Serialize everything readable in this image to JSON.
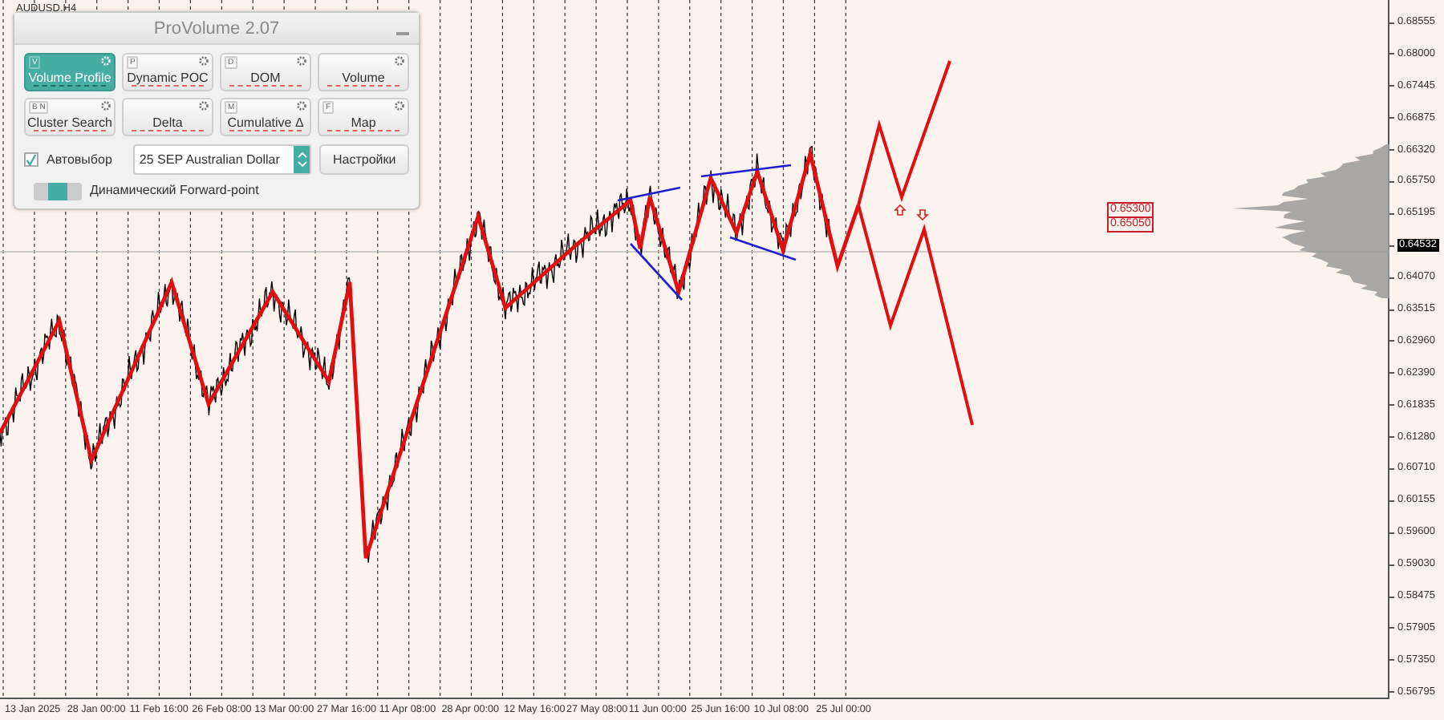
{
  "chart": {
    "symbol": "AUDUSD,H4",
    "price_labels": [
      {
        "text": "0.68555",
        "kind": "tick"
      },
      {
        "text": "0.68000",
        "kind": "tick"
      },
      {
        "text": "0.67445",
        "kind": "tick"
      },
      {
        "text": "0.66875",
        "kind": "tick"
      },
      {
        "text": "0.66320",
        "kind": "tick"
      },
      {
        "text": "0.65750",
        "kind": "tick"
      },
      {
        "text": "0.65195",
        "kind": "tick"
      },
      {
        "text": "0.64532",
        "kind": "current"
      },
      {
        "text": "0.64070",
        "kind": "tick"
      },
      {
        "text": "0.63515",
        "kind": "tick"
      },
      {
        "text": "0.62960",
        "kind": "tick"
      },
      {
        "text": "0.62390",
        "kind": "tick"
      },
      {
        "text": "0.61835",
        "kind": "tick"
      },
      {
        "text": "0.61280",
        "kind": "tick"
      },
      {
        "text": "0.60710",
        "kind": "tick"
      },
      {
        "text": "0.60155",
        "kind": "tick"
      },
      {
        "text": "0.59600",
        "kind": "tick"
      },
      {
        "text": "0.59030",
        "kind": "tick"
      },
      {
        "text": "0.58475",
        "kind": "tick"
      },
      {
        "text": "0.57905",
        "kind": "tick"
      },
      {
        "text": "0.57350",
        "kind": "tick"
      },
      {
        "text": "0.56795",
        "kind": "tick"
      }
    ],
    "time_labels": [
      "13 Jan 2025",
      "28 Jan 00:00",
      "11 Feb 16:00",
      "26 Feb 08:00",
      "13 Mar 00:00",
      "27 Mar 16:00",
      "11 Apr 08:00",
      "28 Apr 00:00",
      "12 May 16:00",
      "27 May 08:00",
      "11 Jun 00:00",
      "25 Jun 16:00",
      "10 Jul 08:00",
      "25 Jul 00:00"
    ],
    "level_tags": [
      "0.65300",
      "0.65050"
    ]
  },
  "panel": {
    "title": "ProVolume 2.07",
    "buttons": [
      {
        "label": "Volume Profile",
        "hotkey": "V",
        "selected": true
      },
      {
        "label": "Dynamic POC",
        "hotkey": "P",
        "selected": false
      },
      {
        "label": "DOM",
        "hotkey": "D",
        "selected": false
      },
      {
        "label": "Volume",
        "selected": false
      },
      {
        "label": "Cluster Search",
        "hotkey": "B N",
        "selected": false
      },
      {
        "label": "Delta",
        "selected": false
      },
      {
        "label": "Cumulative Δ",
        "hotkey": "M",
        "selected": false
      },
      {
        "label": "Map",
        "hotkey": "F",
        "selected": false
      }
    ],
    "auto_select": {
      "label": "Автовыбор",
      "checked": true
    },
    "instrument": {
      "value": "25 SEP Australian Dollar"
    },
    "settings_button": "Настройки",
    "forward_point": {
      "label": "Динамический Forward-point",
      "on": false
    }
  }
}
